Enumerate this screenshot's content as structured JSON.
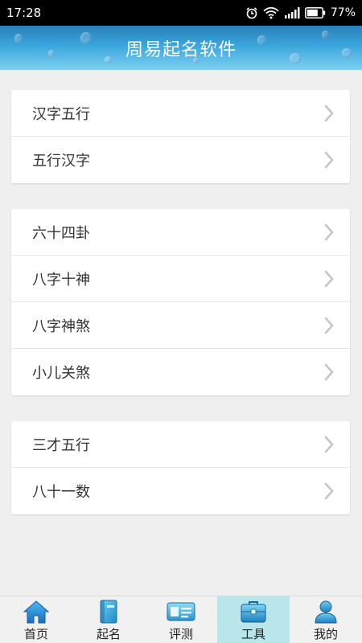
{
  "status_bar": {
    "time": "17:28",
    "battery": "77%",
    "icons": [
      "alarm-icon",
      "wifi-icon",
      "signal-icon",
      "battery-icon"
    ]
  },
  "header": {
    "title": "周易起名软件"
  },
  "groups": [
    {
      "items": [
        {
          "label": "汉字五行"
        },
        {
          "label": "五行汉字"
        }
      ]
    },
    {
      "items": [
        {
          "label": "六十四卦"
        },
        {
          "label": "八字十神"
        },
        {
          "label": "八字神煞"
        },
        {
          "label": "小儿关煞"
        }
      ]
    },
    {
      "items": [
        {
          "label": "三才五行"
        },
        {
          "label": "八十一数"
        }
      ]
    }
  ],
  "tab_bar": {
    "tabs": [
      {
        "label": "首页",
        "icon": "home-icon"
      },
      {
        "label": "起名",
        "icon": "book-icon"
      },
      {
        "label": "评测",
        "icon": "id-card-icon"
      },
      {
        "label": "工具",
        "icon": "briefcase-icon",
        "active": true
      },
      {
        "label": "我的",
        "icon": "user-icon"
      }
    ]
  },
  "colors": {
    "accent": "#3aa6dc",
    "active_tab_bg": "#b8e6eb",
    "background": "#efefef"
  }
}
